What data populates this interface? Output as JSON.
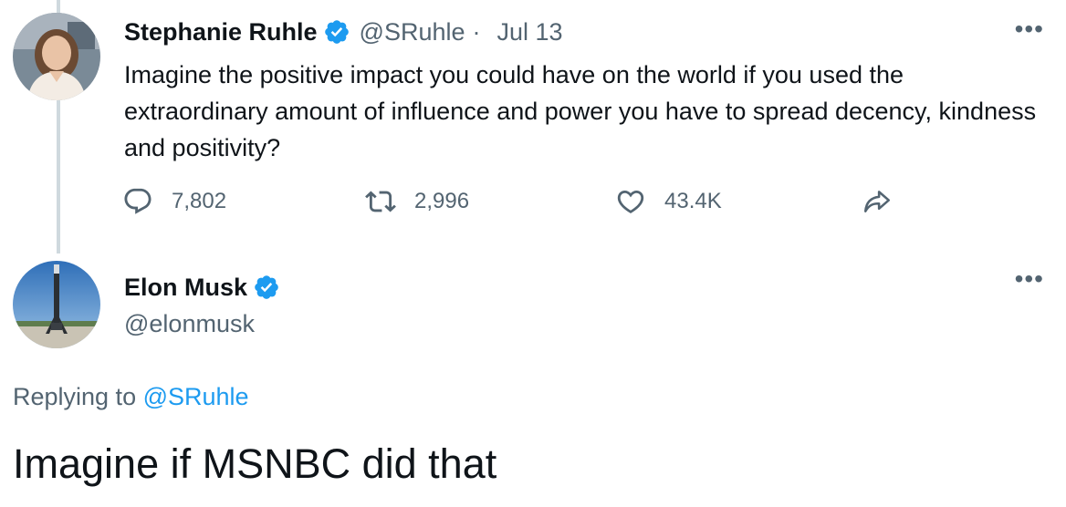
{
  "original_tweet": {
    "author_name": "Stephanie Ruhle",
    "handle": "@SRuhle",
    "separator": "·",
    "date": "Jul 13",
    "text": "Imagine the positive impact you could have on the world if you used the extraordinary amount of influence and power you have to spread decency, kindness and positivity?",
    "replies": "7,802",
    "retweets": "2,996",
    "likes": "43.4K",
    "more_label": "•••"
  },
  "reply_tweet": {
    "author_name": "Elon Musk",
    "handle": "@elonmusk",
    "replying_prefix": "Replying to",
    "replying_to": "@SRuhle",
    "text": "Imagine if MSNBC did that",
    "more_label": "•••"
  },
  "colors": {
    "verified": "#1d9bf0",
    "secondary_text": "#536471",
    "link": "#1d9bf0",
    "thread_line": "#cfd9de"
  }
}
